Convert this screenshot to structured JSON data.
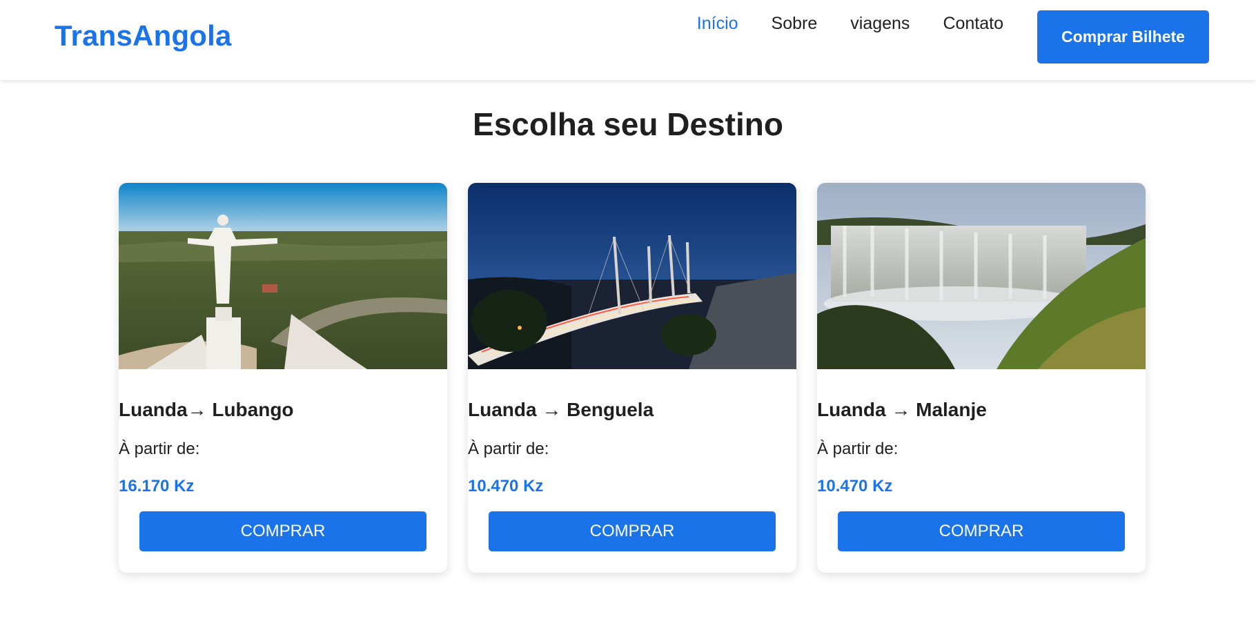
{
  "header": {
    "brand": "TransAngola",
    "nav": [
      {
        "label": "Início",
        "active": true
      },
      {
        "label": "Sobre",
        "active": false
      },
      {
        "label": "viagens",
        "active": false
      },
      {
        "label": "Contato",
        "active": false
      }
    ],
    "cta_label": "Comprar Bilhete"
  },
  "main": {
    "title": "Escolha seu Destino",
    "cards": [
      {
        "route": "Luanda→ Lubango",
        "from_label": "À partir de:",
        "price": "16.170 Kz",
        "button": "COMPRAR",
        "image": "cristo-rei-lubango-photo"
      },
      {
        "route": "Luanda → Benguela",
        "from_label": "À partir de:",
        "price": "10.470 Kz",
        "button": "COMPRAR",
        "image": "cable-bridge-night-photo"
      },
      {
        "route": "Luanda → Malanje",
        "from_label": "À partir de:",
        "price": "10.470 Kz",
        "button": "COMPRAR",
        "image": "kalandula-falls-photo"
      }
    ]
  },
  "colors": {
    "accent": "#1a73e8",
    "text": "#1f1f1f",
    "background": "#ffffff"
  }
}
